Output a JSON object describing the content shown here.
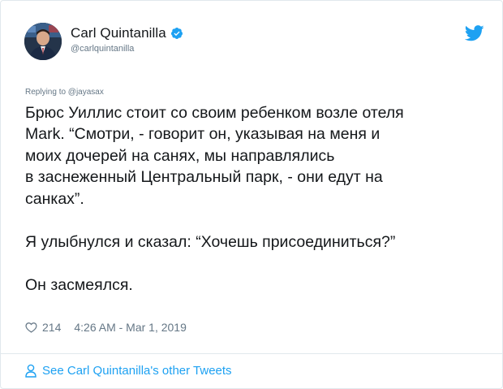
{
  "author": {
    "display_name": "Carl Quintanilla",
    "handle": "@carlquintanilla",
    "verified": true
  },
  "reply_context": "Replying to @jayasax",
  "tweet": {
    "lines_par1": [
      "Брюс Уиллис стоит со своим ребенком возле отеля",
      "Mark. “Смотри, - говорит он, указывая на меня и",
      "моих дочерей на санях, мы направлялись",
      "в заснеженный Центральный парк, - они едут на",
      "санках”."
    ],
    "par2": "Я улыбнулся и сказал: “Хочешь присоединиться?”",
    "par3": "Он засмеялся."
  },
  "meta": {
    "likes": "214",
    "timestamp": "4:26 AM - Mar 1, 2019"
  },
  "footer": {
    "see_more": "See Carl Quintanilla's other Tweets"
  },
  "icons": {
    "verified": "verified-badge-icon",
    "brand": "twitter-bird-icon",
    "like": "heart-outline-icon",
    "profile": "person-outline-icon"
  },
  "colors": {
    "accent": "#1da1f2",
    "text": "#14171a",
    "muted": "#657786",
    "border": "#e1e8ed"
  }
}
